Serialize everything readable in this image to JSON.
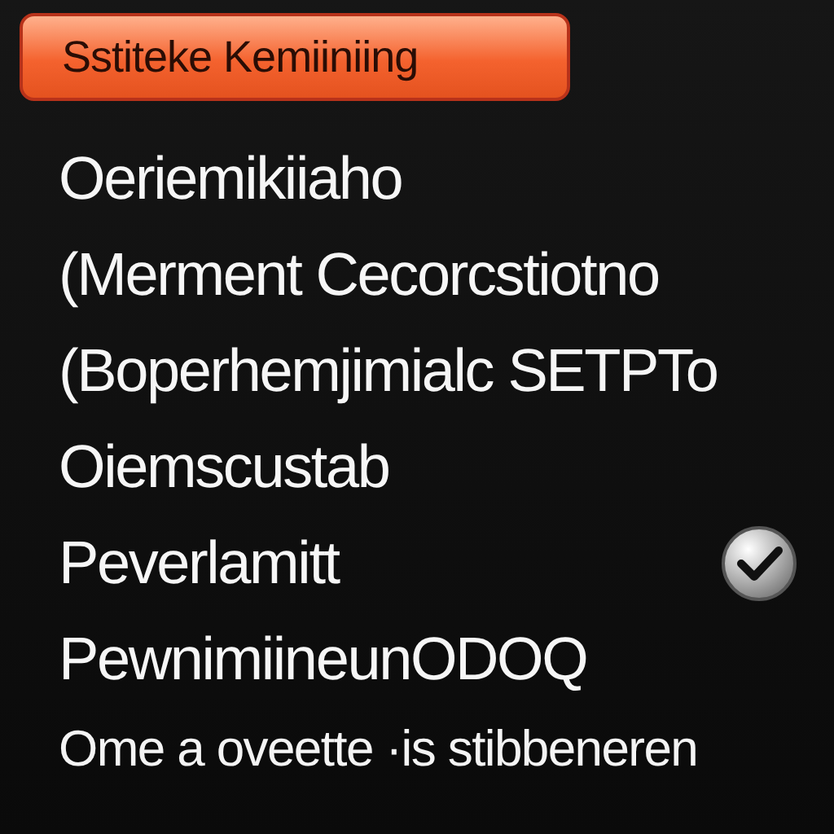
{
  "header_button": {
    "label": "Sstiteke Kemiiniing"
  },
  "items": [
    {
      "label": "Oeriemikiiaho",
      "checked": false
    },
    {
      "label": "(Merment Cecorcstiotno",
      "checked": false
    },
    {
      "label": "(Boperhemjimialc SETPTo",
      "checked": false
    },
    {
      "label": "Oiemscustab",
      "checked": false
    },
    {
      "label": "Peverlamitt",
      "checked": true
    },
    {
      "label": "PewnimiineunODOQ",
      "checked": false
    }
  ],
  "footer": "Ome a oveette ·is stibbeneren"
}
